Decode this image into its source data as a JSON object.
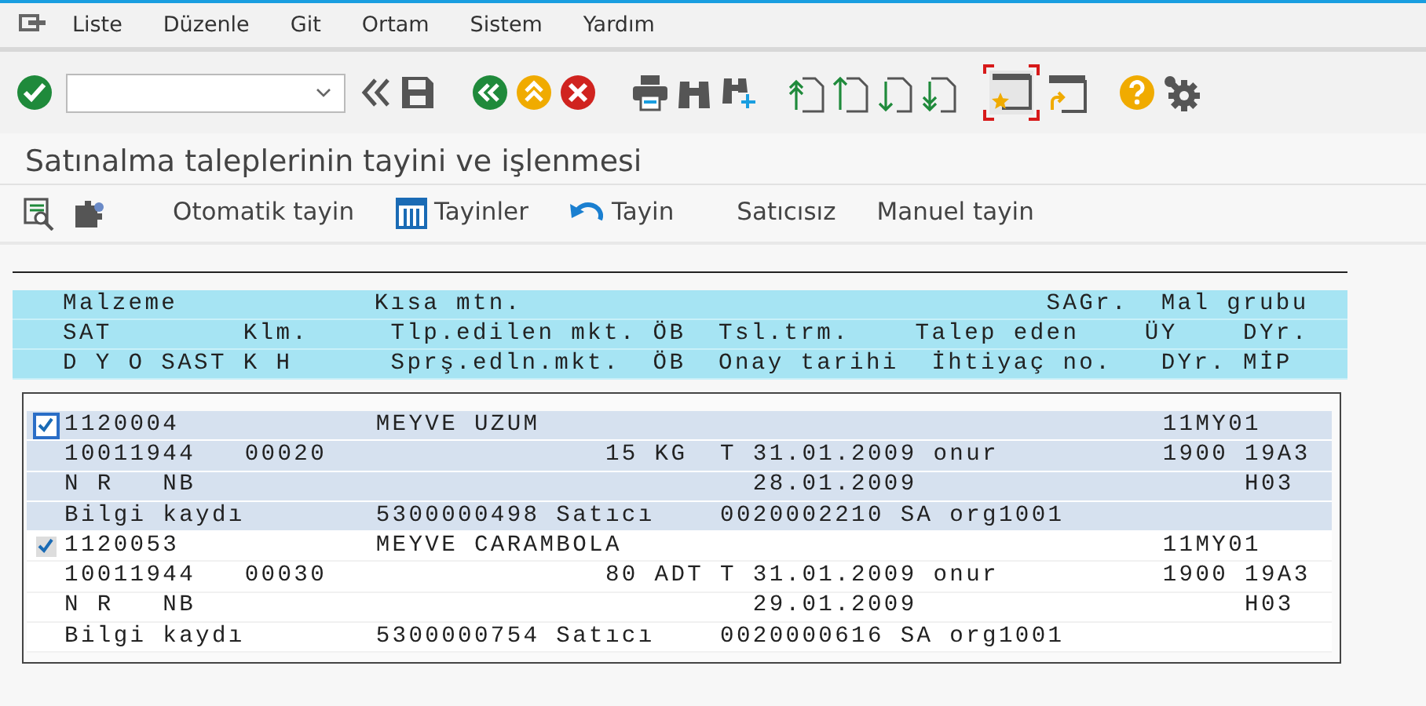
{
  "menu": [
    {
      "label": "Liste"
    },
    {
      "label": "Düzenle"
    },
    {
      "label": "Git"
    },
    {
      "label": "Ortam"
    },
    {
      "label": "Sistem"
    },
    {
      "label": "Yardım"
    }
  ],
  "title": "Satınalma taleplerinin tayini ve işlenmesi",
  "app_toolbar": [
    {
      "label": "Otomatik tayin"
    },
    {
      "label": "Tayinler"
    },
    {
      "label": "Tayin"
    },
    {
      "label": "Satıcısız"
    },
    {
      "label": "Manuel tayin"
    }
  ],
  "header_lines": [
    "Malzeme            Kısa mtn.                                SAGr.  Mal grubu",
    "SAT        Klm.     Tlp.edilen mkt. ÖB  Tsl.trm.    Talep eden    ÜY    DYr.",
    "D Y O SAST K H      Sprş.edln.mkt.  ÖB  Onay tarihi  İhtiyaç no.   DYr. MİP"
  ],
  "items": [
    {
      "checked": true,
      "selected": true,
      "lines": [
        "1120004            MEYVE UZUM                                      11MY01",
        "10011944   00020                 15 KG  T 31.01.2009 onur          1900 19A3",
        "N R   NB                                  28.01.2009                    H03",
        "Bilgi kaydı        5300000498 Satıcı    0020002210 SA org1001"
      ]
    },
    {
      "checked": true,
      "selected": false,
      "lines": [
        "1120053            MEYVE CARAMBOLA                                 11MY01",
        "10011944   00030                 80 ADT T 31.01.2009 onur          1900 19A3",
        "N R   NB                                  29.01.2009                    H03",
        "Bilgi kaydı        5300000754 Satıcı    0020000616 SA org1001"
      ]
    }
  ]
}
